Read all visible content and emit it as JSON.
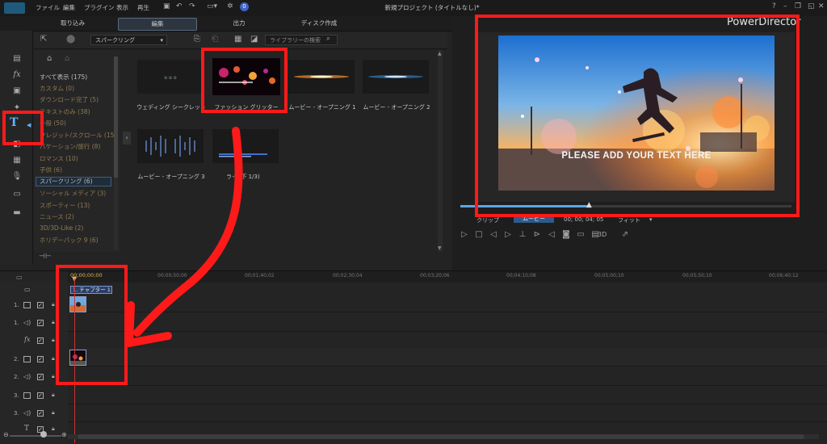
{
  "menu": {
    "file": "ファイル",
    "edit": "編集",
    "plugins": "プラグイン",
    "view": "表示",
    "play": "再生"
  },
  "window_title": "新規プロジェクト (タイトルなし)*",
  "notification_count": "0",
  "mode_tabs": {
    "capture": "取り込み",
    "edit": "編集",
    "output": "出力",
    "disc": "ディスク作成"
  },
  "library": {
    "dropdown_value": "スパークリング",
    "search_placeholder": "ライブラリーの検索",
    "categories": [
      {
        "label": "すべて表示 (175)"
      },
      {
        "label": "カスタム (0)"
      },
      {
        "label": "ダウンロード完了 (5)"
      },
      {
        "label": "テキストのみ (38)"
      },
      {
        "label": "一般 (50)"
      },
      {
        "label": "クレジット/スクロール (15)"
      },
      {
        "label": "バケーション/旅行 (8)"
      },
      {
        "label": "ロマンス (10)"
      },
      {
        "label": "子供 (6)"
      },
      {
        "label": "スパークリング (6)"
      },
      {
        "label": "ソーシャル メディア (3)"
      },
      {
        "label": "スポーティー (13)"
      },
      {
        "label": "ニュース (2)"
      },
      {
        "label": "3D/3D-Like (2)"
      },
      {
        "label": "ホリデーパック 9 (6)"
      }
    ],
    "templates": [
      {
        "label": "ウェディング シークレット"
      },
      {
        "label": "ファッション グリッター"
      },
      {
        "label": "ムービー - オープニング 1"
      },
      {
        "label": "ムービー - オープニング 2"
      },
      {
        "label": "ムービー - オープニング 3"
      },
      {
        "label": "ライ..下 1/3)"
      }
    ]
  },
  "preview": {
    "brand": "PowerDirector",
    "overlay_text": "PLEASE ADD YOUR TEXT HERE",
    "clip_label": "クリップ",
    "movie_label": "ムービー",
    "timecode": "00; 00; 04; 05",
    "fit_label": "フィット",
    "mode_3d": "3D",
    "progress": 0.39
  },
  "timeline": {
    "playhead_time": "00;00;00;00",
    "ruler_ticks": [
      "00;00;50;00",
      "00;01;40;02",
      "00;02;30;04",
      "00;03;20;06",
      "00;04;10;08",
      "00;05;00;10",
      "00;05;50;10",
      "00;06;40;12"
    ],
    "chapter_label": "1. チャプター 1",
    "track_numbers": [
      "1.",
      "1.",
      "2.",
      "2.",
      "3.",
      "3."
    ]
  },
  "colors": {
    "accent": "#5fb6ff",
    "annotation": "#ff1a1a",
    "selection": "#1f2d3b"
  }
}
